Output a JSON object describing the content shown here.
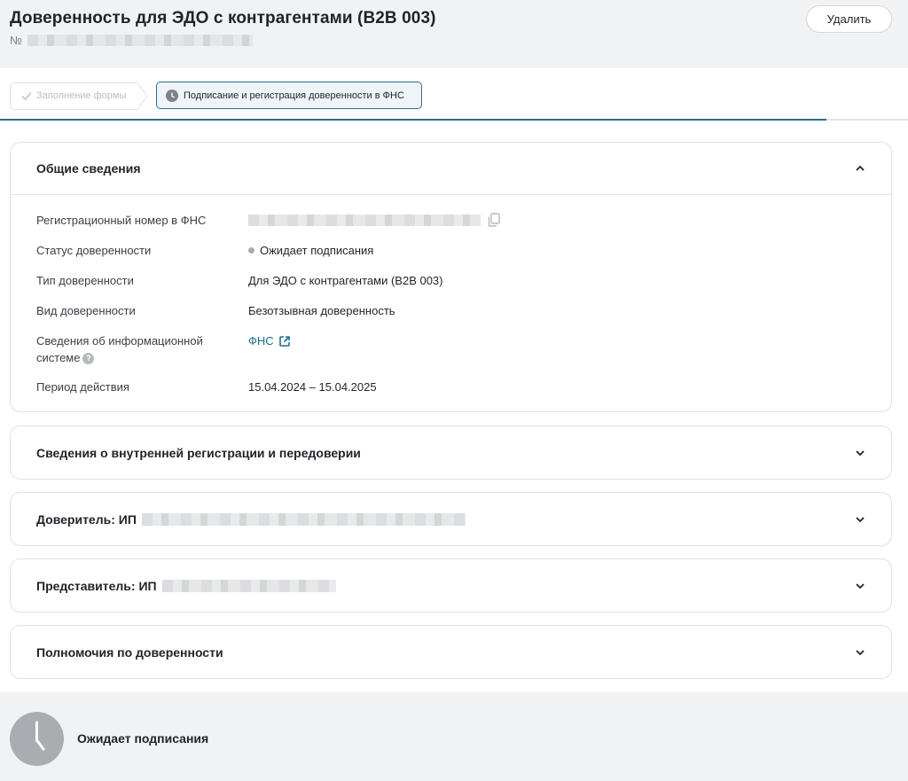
{
  "header": {
    "title": "Доверенность для ЭДО с контрагентами (B2B 003)",
    "number_prefix": "№",
    "delete_label": "Удалить"
  },
  "steps": [
    {
      "label": "Заполнение формы",
      "state": "done",
      "icon": "check-icon"
    },
    {
      "label": "Подписание и регистрация доверенности в ФНС",
      "state": "active",
      "icon": "clock-icon"
    }
  ],
  "progress": 0.91,
  "sections": {
    "general": {
      "title": "Общие сведения",
      "expanded": true,
      "fields": [
        {
          "label": "Регистрационный номер в ФНС"
        },
        {
          "label": "Статус доверенности",
          "value": "Ожидает подписания"
        },
        {
          "label": "Тип доверенности",
          "value": "Для ЭДО с контрагентами (B2B 003)"
        },
        {
          "label": "Вид доверенности",
          "value": "Безотзывная доверенность"
        },
        {
          "label": "Сведения об информационной системе",
          "value": "ФНС"
        },
        {
          "label": "Период действия",
          "value": "15.04.2024 – 15.04.2025"
        }
      ]
    },
    "internal": {
      "title": "Сведения о внутренней регистрации и передоверии"
    },
    "principal": {
      "title": "Доверитель: ИП"
    },
    "representative": {
      "title": "Представитель: ИП"
    },
    "powers": {
      "title": "Полномочия по доверенности"
    }
  },
  "footer": {
    "status": "Ожидает подписания"
  },
  "colors": {
    "accent": "#2b6f8a",
    "link": "#1b6f8f",
    "header_bg": "#f1f2f4"
  }
}
